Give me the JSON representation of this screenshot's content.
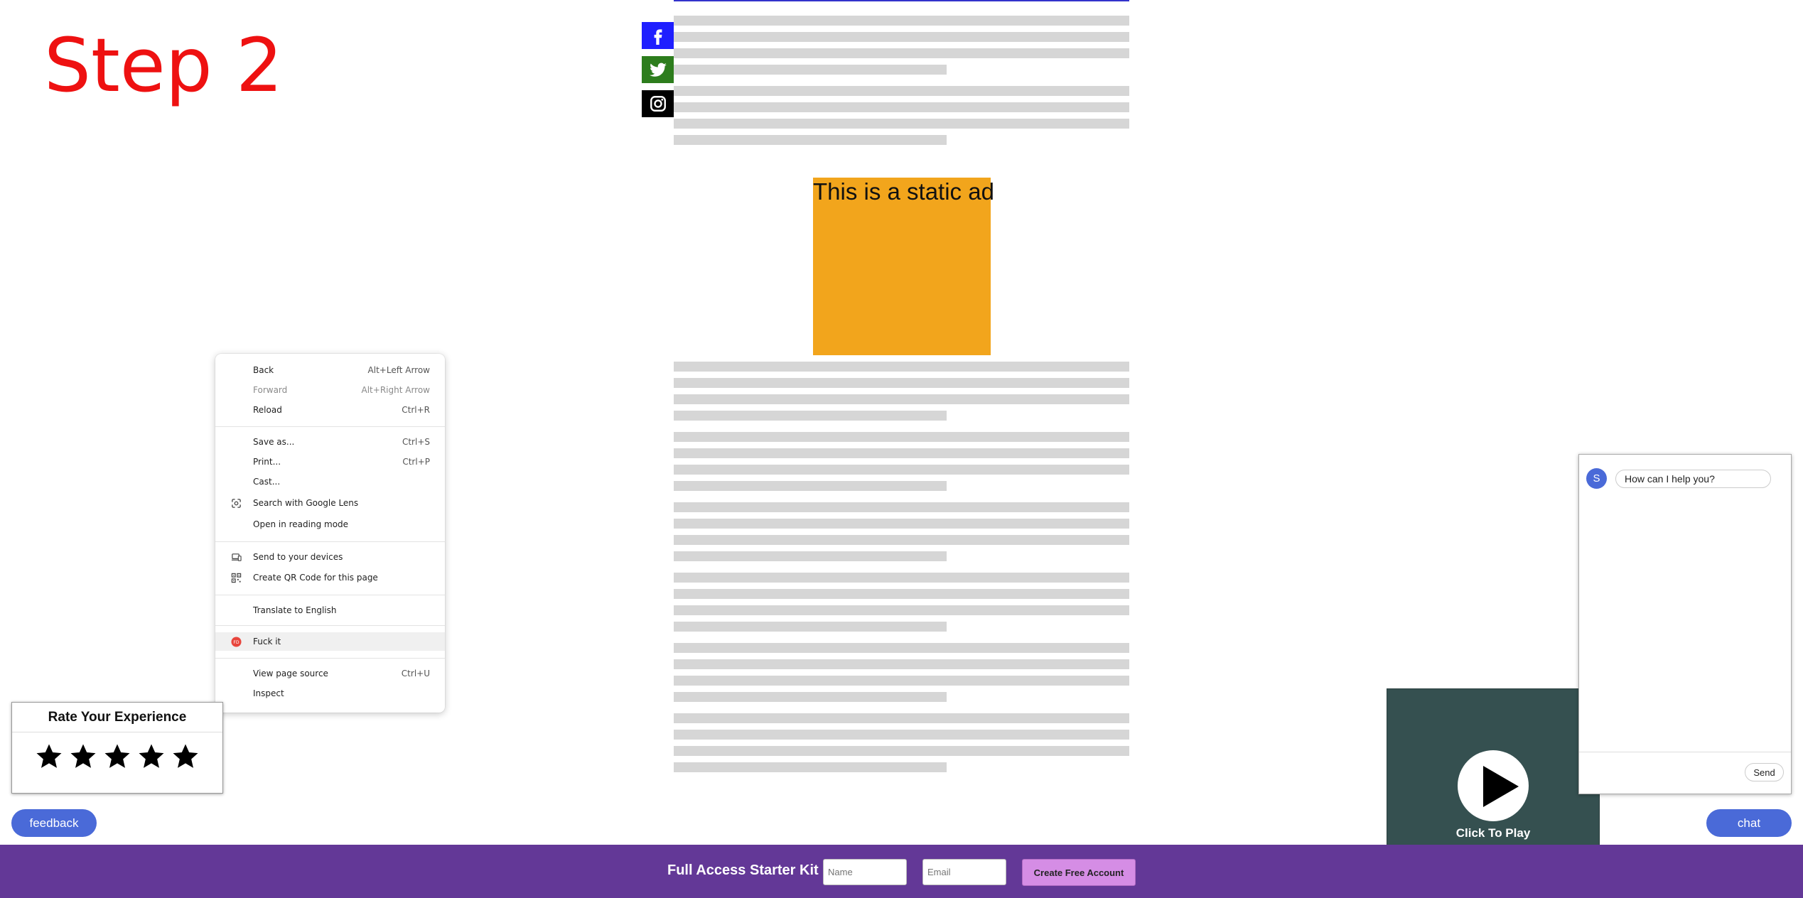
{
  "overlay_label": "Step 2",
  "ad": {
    "text": "This is a static ad"
  },
  "social": [
    "facebook-icon",
    "twitter-icon",
    "instagram-icon"
  ],
  "context_menu": {
    "items": [
      {
        "label": "Back",
        "shortcut": "Alt+Left Arrow"
      },
      {
        "label": "Forward",
        "shortcut": "Alt+Right Arrow",
        "disabled": true
      },
      {
        "label": "Reload",
        "shortcut": "Ctrl+R"
      },
      {
        "label": "Save as...",
        "shortcut": "Ctrl+S"
      },
      {
        "label": "Print...",
        "shortcut": "Ctrl+P"
      },
      {
        "label": "Cast...",
        "shortcut": ""
      },
      {
        "label": "Search with Google Lens",
        "shortcut": "",
        "icon": "google-lens-icon"
      },
      {
        "label": "Open in reading mode",
        "shortcut": ""
      },
      {
        "label": "Send to your devices",
        "shortcut": "",
        "icon": "devices-icon"
      },
      {
        "label": "Create QR Code for this page",
        "shortcut": "",
        "icon": "qr-code-icon"
      },
      {
        "label": "Translate to English",
        "shortcut": ""
      },
      {
        "label": "Fuck it",
        "shortcut": "",
        "icon": "extension-icon",
        "highlighted": true
      },
      {
        "label": "View page source",
        "shortcut": "Ctrl+U"
      },
      {
        "label": "Inspect",
        "shortcut": ""
      }
    ]
  },
  "rating": {
    "title": "Rate Your Experience",
    "max_stars": 5
  },
  "feedback_button": "feedback",
  "chat_button": "chat",
  "chat_panel": {
    "avatar_initial": "S",
    "greeting": "How can I help you?",
    "send_label": "Send"
  },
  "video": {
    "label": "Click To Play"
  },
  "signup_bar": {
    "title": "Full Access Starter Kit",
    "name_placeholder": "Name",
    "email_placeholder": "Email",
    "button_label": "Create Free Account"
  },
  "colors": {
    "overlay_label": "#ee1111",
    "ad_background": "#f2a51c",
    "bar_background": "#633897",
    "accent_button": "#4a6ad8",
    "cta_button": "#d58de5"
  }
}
